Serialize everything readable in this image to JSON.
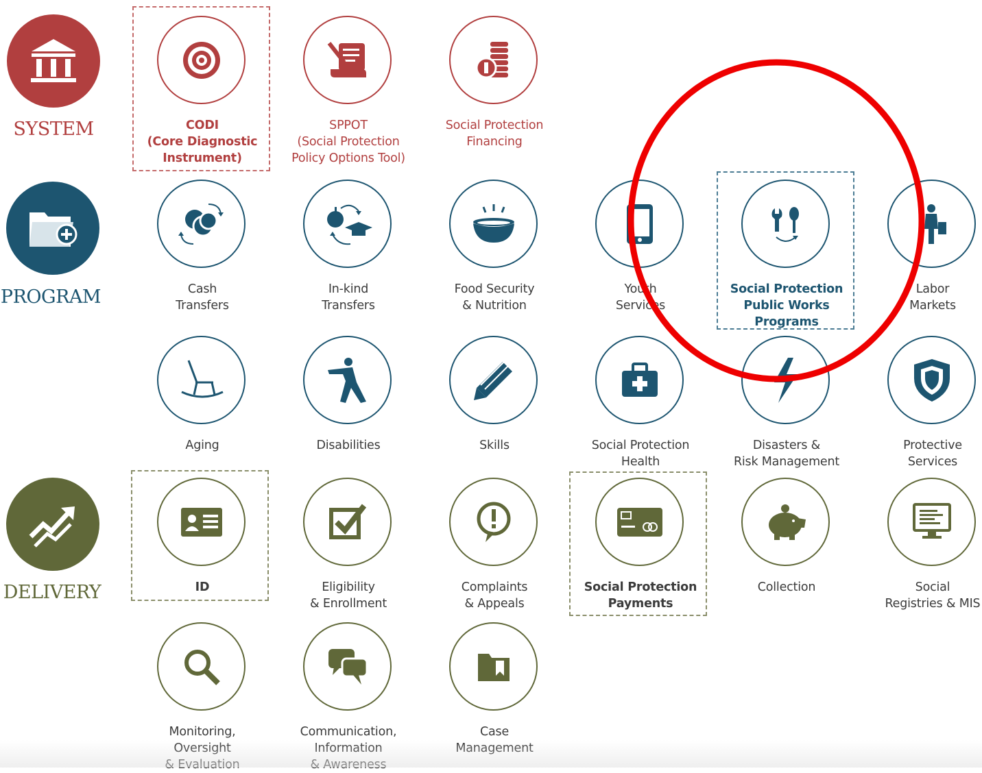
{
  "colors": {
    "system": "#b13f3f",
    "program": "#1d5570",
    "delivery": "#606839",
    "highlight": "#ee0000"
  },
  "categories": {
    "system": {
      "label": "SYSTEM",
      "icon": "institution-building-icon"
    },
    "program": {
      "label": "PROGRAM",
      "icon": "folder-plus-icon"
    },
    "delivery": {
      "label": "DELIVERY",
      "icon": "trend-arrows-icon"
    }
  },
  "tools": {
    "codi": {
      "label": "CODI\n(Core Diagnostic\nInstrument)",
      "icon": "target-icon"
    },
    "sppot": {
      "label": "SPPOT\n(Social Protection\nPolicy Options Tool)",
      "icon": "scroll-pen-icon"
    },
    "financing": {
      "label": "Social Protection\nFinancing",
      "icon": "coin-stack-icon"
    },
    "cash": {
      "label": "Cash\nTransfers",
      "icon": "coins-cycle-icon"
    },
    "inkind": {
      "label": "In-kind\nTransfers",
      "icon": "apple-graduation-cap-icon"
    },
    "food": {
      "label": "Food Security\n& Nutrition",
      "icon": "bowl-icon"
    },
    "youth": {
      "label": "Youth\nServices",
      "icon": "tablet-icon"
    },
    "publicworks": {
      "label": "Social Protection\nPublic Works\nPrograms",
      "icon": "wrench-spoon-cycle-icon"
    },
    "labor": {
      "label": "Labor\nMarkets",
      "icon": "worker-icon"
    },
    "aging": {
      "label": "Aging",
      "icon": "rocking-chair-icon"
    },
    "disabilities": {
      "label": "Disabilities",
      "icon": "person-reaching-icon"
    },
    "skills": {
      "label": "Skills",
      "icon": "pencil-icon"
    },
    "health": {
      "label": "Social Protection\nHealth",
      "icon": "medical-kit-icon"
    },
    "disasters": {
      "label": "Disasters &\nRisk Management",
      "icon": "lightning-icon"
    },
    "protective": {
      "label": "Protective\nServices",
      "icon": "shield-icon"
    },
    "id": {
      "label": "ID",
      "icon": "id-card-icon"
    },
    "eligibility": {
      "label": "Eligibility\n& Enrollment",
      "icon": "checkbox-icon"
    },
    "complaints": {
      "label": "Complaints\n& Appeals",
      "icon": "exclamation-bubble-icon"
    },
    "payments": {
      "label": "Social Protection\nPayments",
      "icon": "payment-card-icon"
    },
    "collection": {
      "label": "Collection",
      "icon": "piggy-bank-icon"
    },
    "registries": {
      "label": "Social\nRegistries & MIS",
      "icon": "computer-monitor-icon"
    },
    "monitoring": {
      "label": "Monitoring,\nOversight\n& Evaluation",
      "icon": "magnifier-icon"
    },
    "communication": {
      "label": "Communication,\nInformation\n& Awareness",
      "icon": "chat-bubbles-icon"
    },
    "casemgmt": {
      "label": "Case\nManagement",
      "icon": "folder-icon"
    }
  }
}
